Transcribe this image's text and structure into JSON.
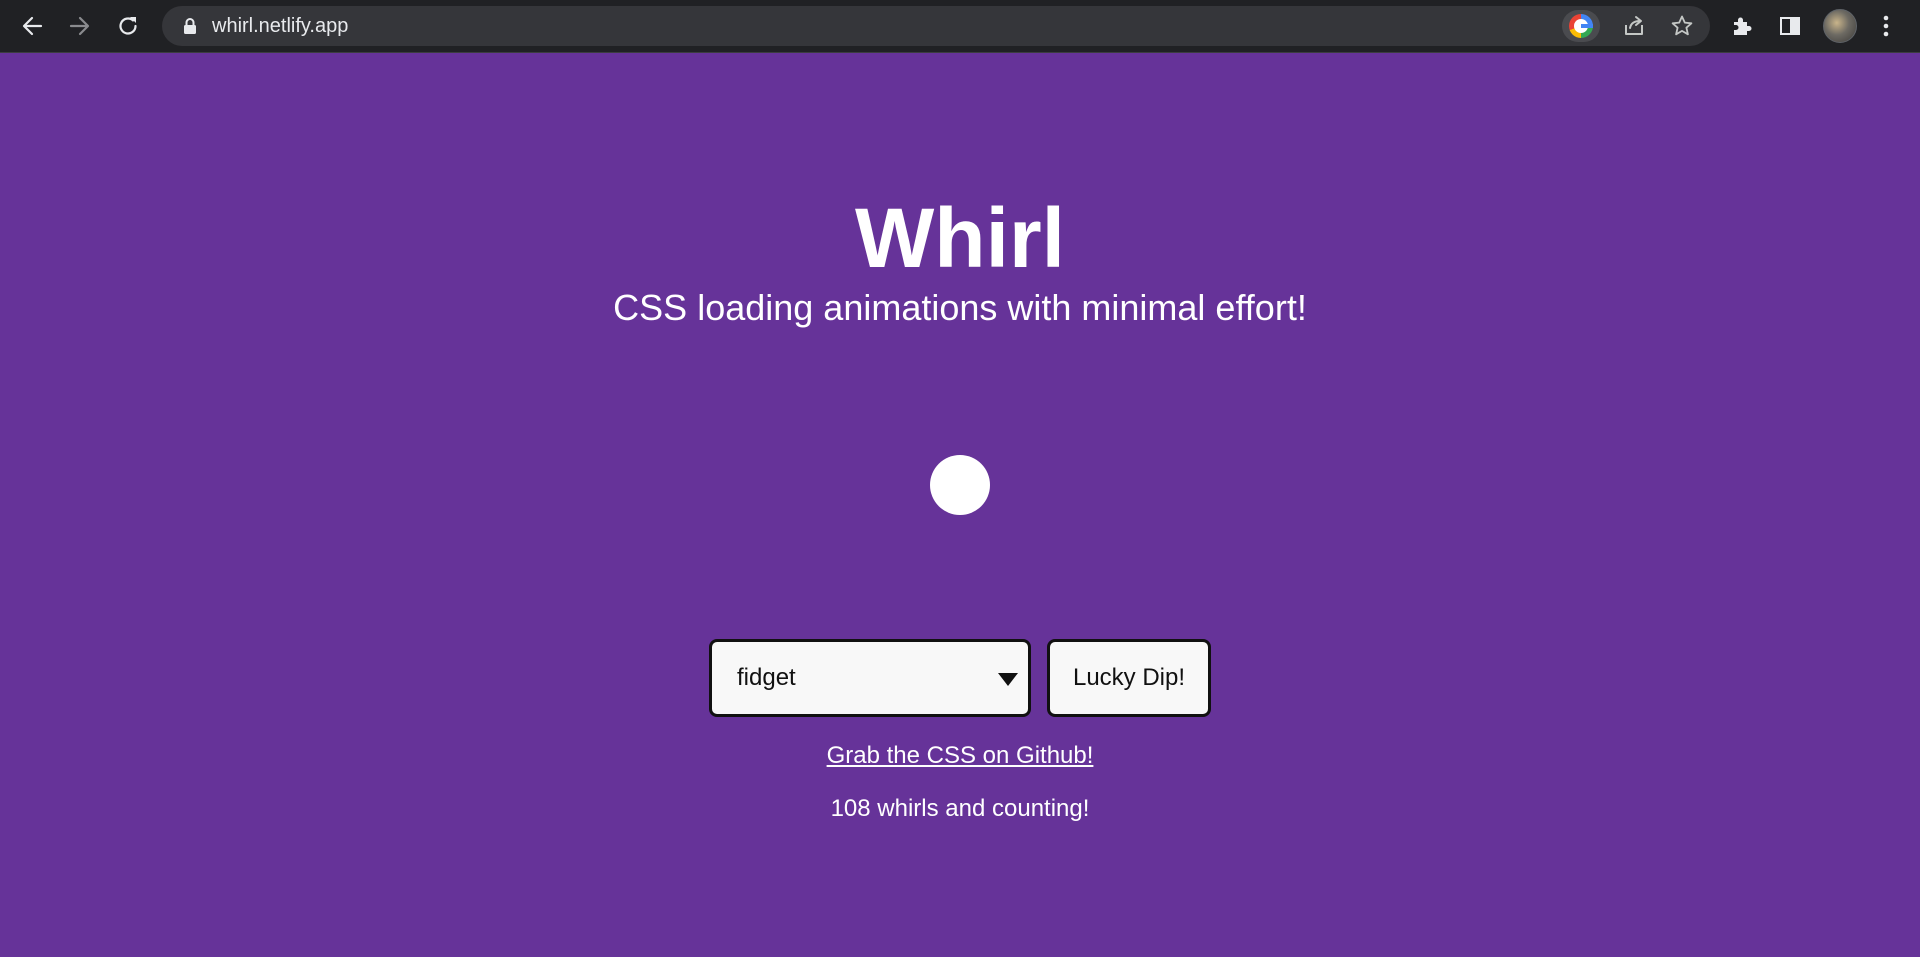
{
  "browser": {
    "url": "whirl.netlify.app",
    "icons": {
      "back": "back-arrow-icon",
      "forward": "forward-arrow-icon",
      "reload": "reload-icon",
      "lock": "lock-icon",
      "google": "google-lens-icon",
      "share": "share-icon",
      "bookmark": "star-icon",
      "extensions": "puzzle-icon",
      "side_panel": "side-panel-icon",
      "profile": "avatar",
      "menu": "kebab-menu-icon"
    },
    "colors": {
      "toolbar": "#202124",
      "omnibox": "#35363a",
      "text": "#e8eaed"
    }
  },
  "page": {
    "title": "Whirl",
    "subtitle": "CSS loading animations with minimal effort!",
    "background": "#663399",
    "select": {
      "selected": "fidget"
    },
    "lucky_button": "Lucky Dip!",
    "github_link": "Grab the CSS on Github!",
    "counter": "108 whirls and counting!"
  }
}
